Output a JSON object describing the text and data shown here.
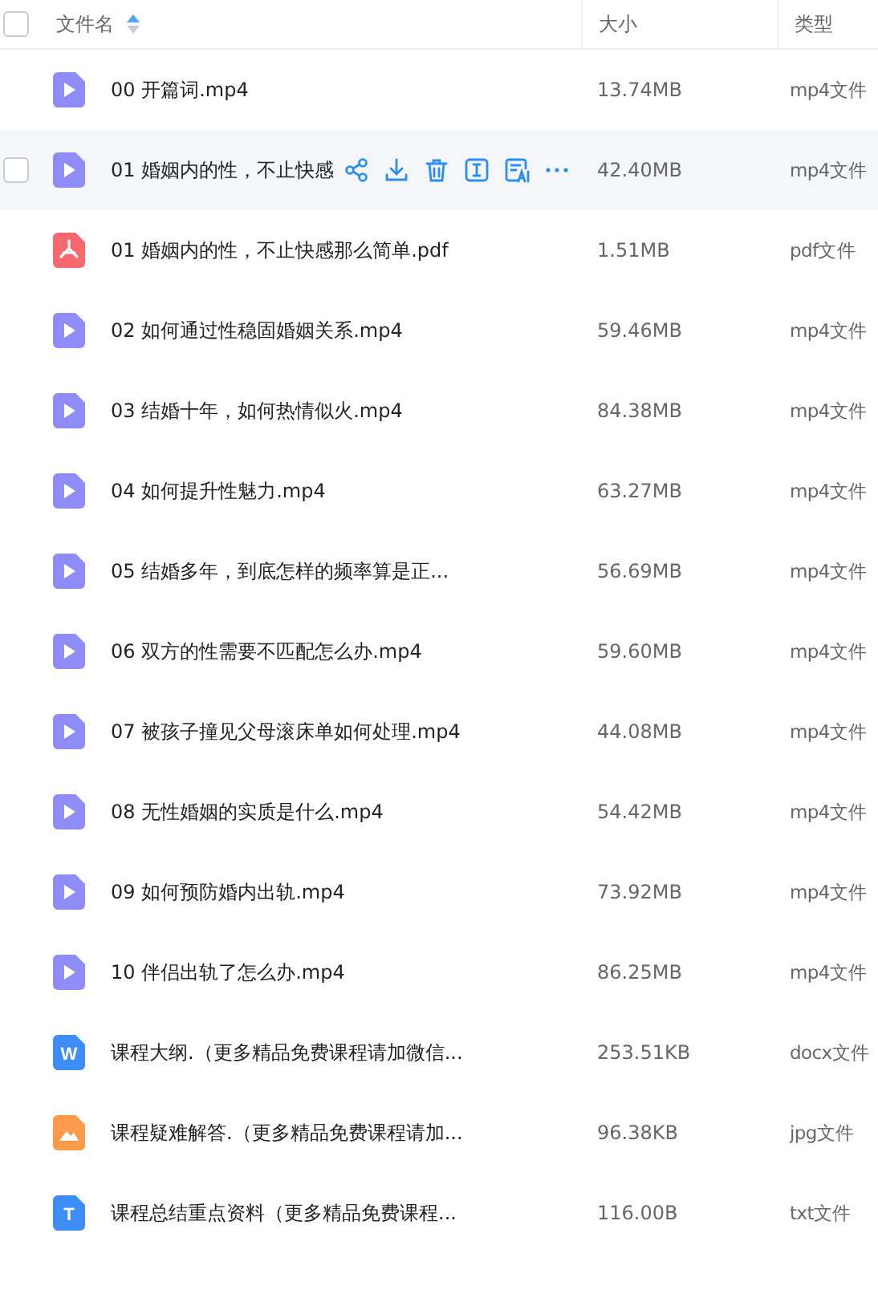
{
  "select_all": {
    "checked": false
  },
  "columns": [
    {
      "label": "文件名",
      "sorted": true
    },
    {
      "label": "大小",
      "sorted": false
    },
    {
      "label": "类型",
      "sorted": false
    }
  ],
  "rows": [
    {
      "kind": "video",
      "name": "00 开篇词.mp4",
      "size": "13.74MB",
      "type": "mp4文件",
      "hovered": false
    },
    {
      "kind": "video",
      "name": "01 婚姻内的性，不止快感",
      "size": "42.40MB",
      "type": "mp4文件",
      "hovered": true
    },
    {
      "kind": "pdf",
      "name": "01 婚姻内的性，不止快感那么简单.pdf",
      "size": "1.51MB",
      "type": "pdf文件",
      "hovered": false
    },
    {
      "kind": "video",
      "name": "02 如何通过性稳固婚姻关系.mp4",
      "size": "59.46MB",
      "type": "mp4文件",
      "hovered": false
    },
    {
      "kind": "video",
      "name": "03 结婚十年，如何热情似火.mp4",
      "size": "84.38MB",
      "type": "mp4文件",
      "hovered": false
    },
    {
      "kind": "video",
      "name": "04 如何提升性魅力.mp4",
      "size": "63.27MB",
      "type": "mp4文件",
      "hovered": false
    },
    {
      "kind": "video",
      "name": "05 结婚多年，到底怎样的频率算是正...",
      "size": "56.69MB",
      "type": "mp4文件",
      "hovered": false
    },
    {
      "kind": "video",
      "name": "06 双方的性需要不匹配怎么办.mp4",
      "size": "59.60MB",
      "type": "mp4文件",
      "hovered": false
    },
    {
      "kind": "video",
      "name": "07 被孩子撞见父母滚床单如何处理.mp4",
      "size": "44.08MB",
      "type": "mp4文件",
      "hovered": false
    },
    {
      "kind": "video",
      "name": "08 无性婚姻的实质是什么.mp4",
      "size": "54.42MB",
      "type": "mp4文件",
      "hovered": false
    },
    {
      "kind": "video",
      "name": "09 如何预防婚内出轨.mp4",
      "size": "73.92MB",
      "type": "mp4文件",
      "hovered": false
    },
    {
      "kind": "video",
      "name": "10 伴侣出轨了怎么办.mp4",
      "size": "86.25MB",
      "type": "mp4文件",
      "hovered": false
    },
    {
      "kind": "doc",
      "icon_glyph": "W",
      "name": "课程大纲.（更多精品免费课程请加微信...",
      "size": "253.51KB",
      "type": "docx文件",
      "hovered": false
    },
    {
      "kind": "image",
      "name": "课程疑难解答.（更多精品免费课程请加...",
      "size": "96.38KB",
      "type": "jpg文件",
      "hovered": false
    },
    {
      "kind": "text",
      "icon_glyph": "T",
      "name": "课程总结重点资料（更多精品免费课程...",
      "size": "116.00B",
      "type": "txt文件",
      "hovered": false
    }
  ]
}
